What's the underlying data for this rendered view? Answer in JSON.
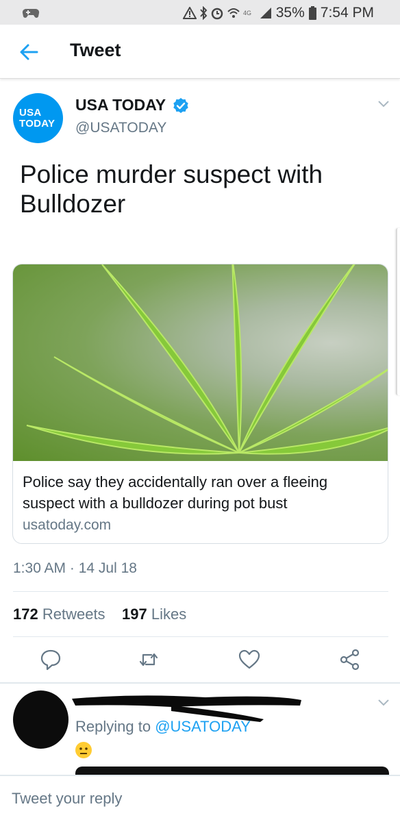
{
  "status_bar": {
    "battery": "35%",
    "time": "7:54 PM"
  },
  "app_bar": {
    "title": "Tweet"
  },
  "tweet": {
    "avatar_text_line1": "USA",
    "avatar_text_line2": "TODAY",
    "author_name": "USA TODAY",
    "handle": "@USATODAY",
    "text": "Police murder suspect with Bulldozer",
    "card": {
      "title": "Police say they accidentally ran over a fleeing suspect with a bulldozer during pot bust",
      "domain": "usatoday.com"
    },
    "timestamp": "1:30 AM · 14 Jul 18",
    "retweets_count": "172",
    "retweets_label": "Retweets",
    "likes_count": "197",
    "likes_label": "Likes"
  },
  "reply": {
    "replying_prefix": "Replying to",
    "replying_handle": "@USATODAY",
    "emoji": "😐"
  },
  "composer": {
    "placeholder": "Tweet your reply"
  },
  "colors": {
    "accent": "#1da1f2",
    "brand_usa_today": "#0098f0",
    "secondary_text": "#657786"
  }
}
